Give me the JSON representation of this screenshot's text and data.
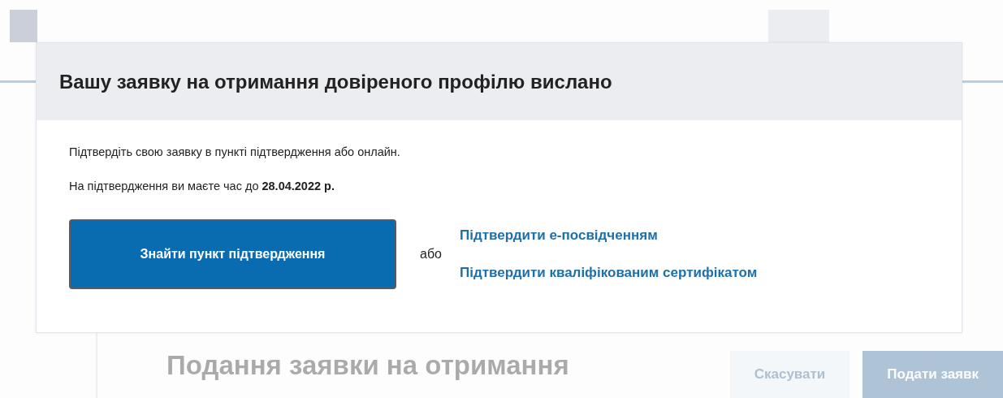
{
  "background": {
    "headline": "Подання заявки на отримання",
    "buttons": [
      {
        "label": "Скасувати",
        "kind": "secondary"
      },
      {
        "label": "Подати заявк",
        "kind": "primary"
      }
    ]
  },
  "dialog": {
    "title": "Вашу заявку на отримання довіреного профілю вислано",
    "lines": [
      "Підтвердіть свою заявку в пункті підтвердження або онлайн.",
      "На підтвердження ви маєте час до **28.04.2022 р.**"
    ],
    "primary_button": "Знайти пункт підтвердження",
    "separator": "або",
    "links": [
      "Підтвердити е-посвідченням",
      "Підтвердити кваліфікованим сертифікатом"
    ]
  }
}
